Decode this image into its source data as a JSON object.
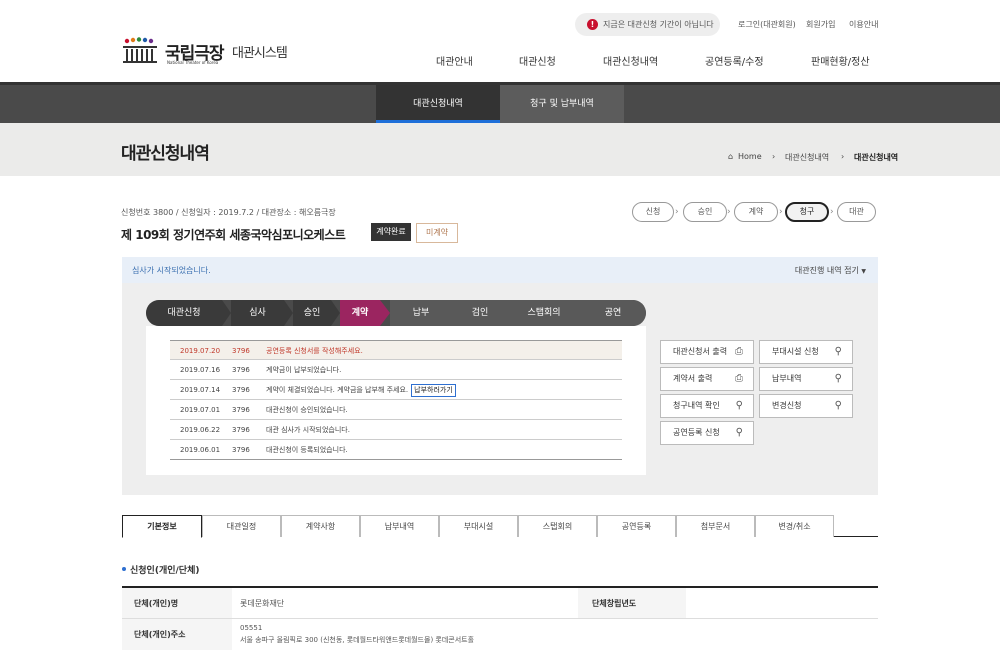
{
  "header": {
    "notice": "지금은 대관신청 기간이 아닙니다",
    "util_links": [
      "로그인(대관회원)",
      "회원가입",
      "이용안내"
    ],
    "logo": {
      "name": "국립극장",
      "english": "National Theater of Korea",
      "system": "대관시스템"
    },
    "gnb": [
      "대관안내",
      "대관신청",
      "대관신청내역",
      "공연등록/수정",
      "판매현황/정산"
    ]
  },
  "subnav": {
    "tabs": [
      "대관신청내역",
      "청구 및 납부내역"
    ]
  },
  "page": {
    "title": "대관신청내역",
    "breadcrumb": [
      "Home",
      "대관신청내역",
      "대관신청내역"
    ]
  },
  "application": {
    "meta": "신청번호 3800 / 신청일자 : 2019.7.2 / 대관장소 : 해오름극장",
    "title": "제 109회 정기연주회 세종국악심포니오케스트",
    "badge_contract": "계약완료",
    "badge_status": "미계약",
    "steps": [
      "신청",
      "승인",
      "계약",
      "청구",
      "대관"
    ],
    "current_step": "청구"
  },
  "status": {
    "message": "심사가 시작되었습니다.",
    "toggle": "대관진행 내역 접기"
  },
  "progress": {
    "stages": [
      "대관신청",
      "심사",
      "승인",
      "계약",
      "납부",
      "검인",
      "스탭회의",
      "공연"
    ],
    "current": "계약"
  },
  "history": [
    {
      "date": "2019.07.20",
      "no": "3796",
      "text": "공연등록 신청서를 작성해주세요."
    },
    {
      "date": "2019.07.16",
      "no": "3796",
      "text": "계약금이 납부되었습니다."
    },
    {
      "date": "2019.07.14",
      "no": "3796",
      "text": "계약이 체결되었습니다. 계약금을 납부해 주세요.",
      "button": "납부하러가기"
    },
    {
      "date": "2019.07.01",
      "no": "3796",
      "text": "대관신청이 승인되었습니다."
    },
    {
      "date": "2019.06.22",
      "no": "3796",
      "text": "대관 심사가 시작되었습니다."
    },
    {
      "date": "2019.06.01",
      "no": "3796",
      "text": "대관신청이 등록되었습니다."
    }
  ],
  "actions": [
    "대관신청서 출력",
    "부대시설 신청",
    "계약서 출력",
    "납부내역",
    "청구내역 확인",
    "변경신청",
    "공연등록 신청"
  ],
  "detail_tabs": [
    "기본정보",
    "대관일정",
    "계약사항",
    "납부내역",
    "부대시설",
    "스탭회의",
    "공연등록",
    "첨부문서",
    "변경/취소"
  ],
  "applicant": {
    "section": "신청인(개인/단체)",
    "name_label": "단체(개인)명",
    "name_value": "롯데문화재단",
    "year_label": "단체창립년도",
    "year_value": "",
    "addr_label": "단체(개인)주소",
    "zip": "05551",
    "addr": "서울 송파구 올림픽로 300 (신천동, 롯데월드타워앤드롯데월드몰) 롯데콘서트홀"
  }
}
